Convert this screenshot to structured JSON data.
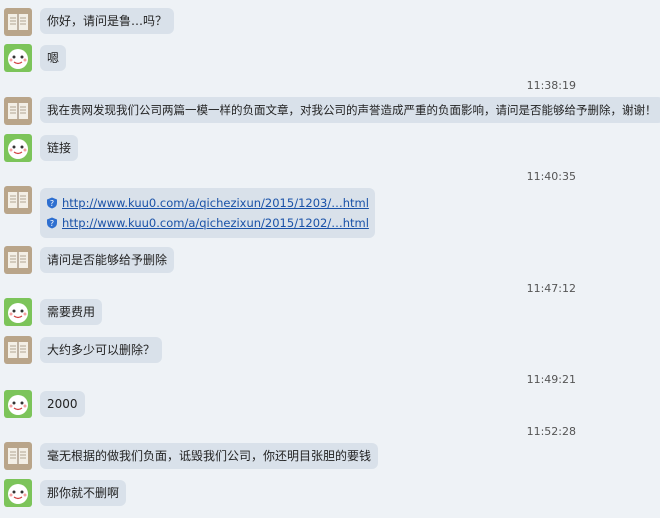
{
  "messages": [
    {
      "sender": "customer",
      "text": "你好，请问是鲁…吗？"
    },
    {
      "sender": "agent",
      "text": "嗯"
    },
    {
      "timestamp": "11:38:19"
    },
    {
      "sender": "customer",
      "text": "我在贵网发现我们公司两篇一模一样的负面文章，对我公司的声誉造成严重的负面影响，请问是否能够给予删除，谢谢！"
    },
    {
      "sender": "agent",
      "text": "链接"
    },
    {
      "timestamp": "11:40:35"
    },
    {
      "sender": "customer",
      "links": [
        "http://www.kuu0.com/a/qichezixun/2015/1203/…html",
        "http://www.kuu0.com/a/qichezixun/2015/1202/…html"
      ]
    },
    {
      "sender": "customer",
      "text": "请问是否能够给予删除"
    },
    {
      "timestamp": "11:47:12"
    },
    {
      "sender": "agent",
      "text": "需要费用"
    },
    {
      "sender": "customer",
      "text": "大约多少可以删除？"
    },
    {
      "timestamp": "11:49:21"
    },
    {
      "sender": "agent",
      "text": "2000"
    },
    {
      "timestamp": "11:52:28"
    },
    {
      "sender": "customer",
      "text": "毫无根据的做我们负面，诋毁我们公司，你还明目张胆的要钱"
    },
    {
      "sender": "customer",
      "text": "那你就不删啊"
    }
  ],
  "icons": {
    "customer_avatar": "book-avatar-icon",
    "agent_avatar": "cartoon-face-avatar-icon",
    "link_icon": "question-shield-icon"
  },
  "colors": {
    "background": "#eef2f6",
    "bubble": "#d9e1ea",
    "link": "#1a52a8"
  }
}
